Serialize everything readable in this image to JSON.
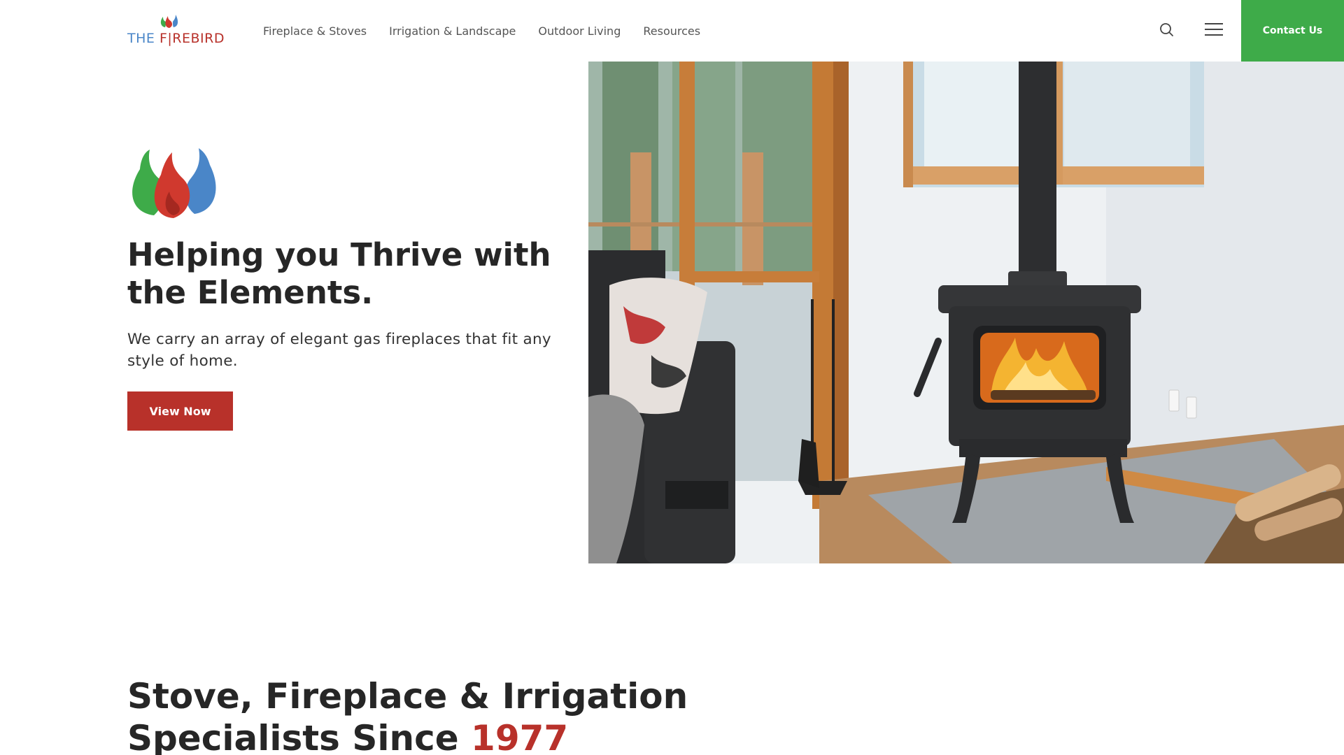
{
  "brand": {
    "logo_the": "THE ",
    "logo_name": "F|REBIRD"
  },
  "nav": {
    "items": [
      {
        "label": "Fireplace & Stoves"
      },
      {
        "label": "Irrigation & Landscape"
      },
      {
        "label": "Outdoor Living"
      },
      {
        "label": "Resources"
      }
    ],
    "contact_label": "Contact Us"
  },
  "hero": {
    "title": "Helping you Thrive with the Elements.",
    "text": "We carry an array of elegant gas fireplaces that fit any style of home.",
    "button_label": "View Now"
  },
  "section": {
    "title_part1": "Stove, Fireplace & Irrigation Specialists Since ",
    "title_year": "1977"
  },
  "colors": {
    "green": "#3eab49",
    "red": "#b8312a",
    "blue": "#4a86c8"
  }
}
